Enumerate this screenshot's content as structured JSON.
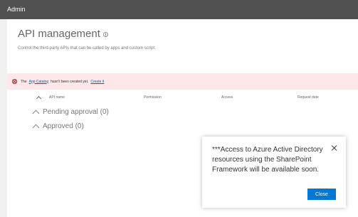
{
  "topbar": {
    "title": "Admin"
  },
  "page": {
    "title": "API management",
    "description": "Control the third-party APIs that can be called by apps and custom script."
  },
  "error_bar": {
    "text_before": "The",
    "link_app_catalog": "App Catalog",
    "text_middle": "hasn't been created yet.",
    "link_create": "Create it"
  },
  "table": {
    "columns": [
      "API name",
      "Permission",
      "Access",
      "Request date"
    ],
    "groups": [
      {
        "label": "Pending approval (0)"
      },
      {
        "label": "Approved (0)"
      }
    ]
  },
  "dialog": {
    "message": "***Access to Azure Active Directory resources using the SharePoint Framework will be available soon.",
    "close_label": "Close"
  }
}
